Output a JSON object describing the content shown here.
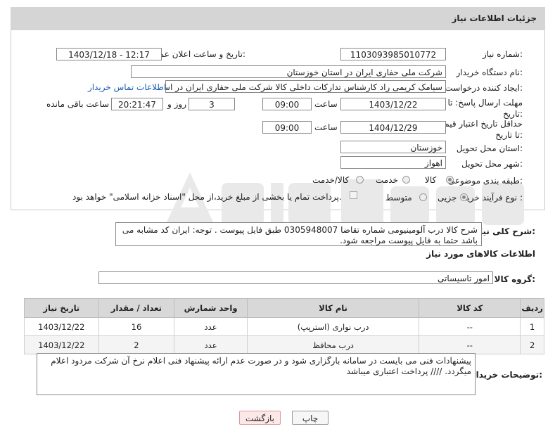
{
  "page": {
    "title": "جزئیات اطلاعات نیاز"
  },
  "fields": {
    "need_number_label": "شماره نیاز:",
    "need_number": "1103093985010772",
    "announce_label": "تاریخ و ساعت اعلان عمومی:",
    "announce_value": "1403/12/18 - 12:17",
    "buyer_label": "نام دستگاه خریدار:",
    "buyer_value": "شرکت ملی حفاری ایران در استان خوزستان",
    "creator_label": "ایجاد کننده درخواست:",
    "creator_value": "سیامک کریمی راد کارشناس تدارکات داخلی کالا شرکت ملی حفاری ایران در اس",
    "contact_link": "اطلاعات تماس خریدار",
    "deadline_label": "مهلت ارسال پاسخ: تا تاریخ:",
    "deadline_date": "1403/12/22",
    "time_label": "ساعت",
    "deadline_time": "09:00",
    "days_value": "3",
    "days_label": "روز و",
    "remaining_time": "20:21:47",
    "remaining_label": "ساعت باقی مانده",
    "validity_label": "حداقل تاریخ اعتبار قیمت: تا تاریخ:",
    "validity_date": "1404/12/29",
    "validity_time": "09:00",
    "province_label": "استان محل تحویل:",
    "province_value": "خوزستان",
    "city_label": "شهر محل تحویل:",
    "city_value": "اهواز",
    "category_label": "طبقه بندی موضوعی:",
    "category_goods": "کالا",
    "category_service": "خدمت",
    "category_both": "کالا/خدمت",
    "process_label": "نوع فرآیند خرید :",
    "process_partial": "جزیی",
    "process_medium": "متوسط",
    "process_note": "پرداخت تمام یا بخشی از مبلغ خرید،از محل \"اسناد خزانه اسلامی\" خواهد بود."
  },
  "description": {
    "label": "شرح کلی نیاز:",
    "text": "شرح کالا درب آلومینیومی شماره تقاضا 0305948007  طبق فایل پیوست . توجه: ایران کد مشابه می باشد حتما به فایل پیوست مراجعه شود."
  },
  "goods": {
    "section_title": "اطلاعات کالاهای مورد نیاز",
    "group_label": "گروه کالا:",
    "group_value": "امور تاسیساتی",
    "columns": [
      "ردیف",
      "کد کالا",
      "نام کالا",
      "واحد شمارش",
      "تعداد / مقدار",
      "تاریخ نیاز"
    ],
    "rows": [
      {
        "row": "1",
        "code": "--",
        "name": "درب نواری (استرپپ)",
        "unit": "عدد",
        "qty": "16",
        "date": "1403/12/22"
      },
      {
        "row": "2",
        "code": "--",
        "name": "درب محافظ",
        "unit": "عدد",
        "qty": "2",
        "date": "1403/12/22"
      }
    ]
  },
  "buyer_notes": {
    "label": "توضیحات خریدار:",
    "text": "پیشنهادات فنی می بایست در سامانه بارگزاری شود و در صورت عدم ارائه پیشنهاد فنی اعلام نرخ آن شرکت مردود اعلام میگردد.  //// پرداخت اعتباری میباشد"
  },
  "buttons": {
    "print": "چاپ",
    "back": "بازگشت"
  },
  "colors": {
    "header_bg": "#d5d5d5",
    "link": "#1a5fb4",
    "back_btn_bg": "#fde8e8"
  }
}
